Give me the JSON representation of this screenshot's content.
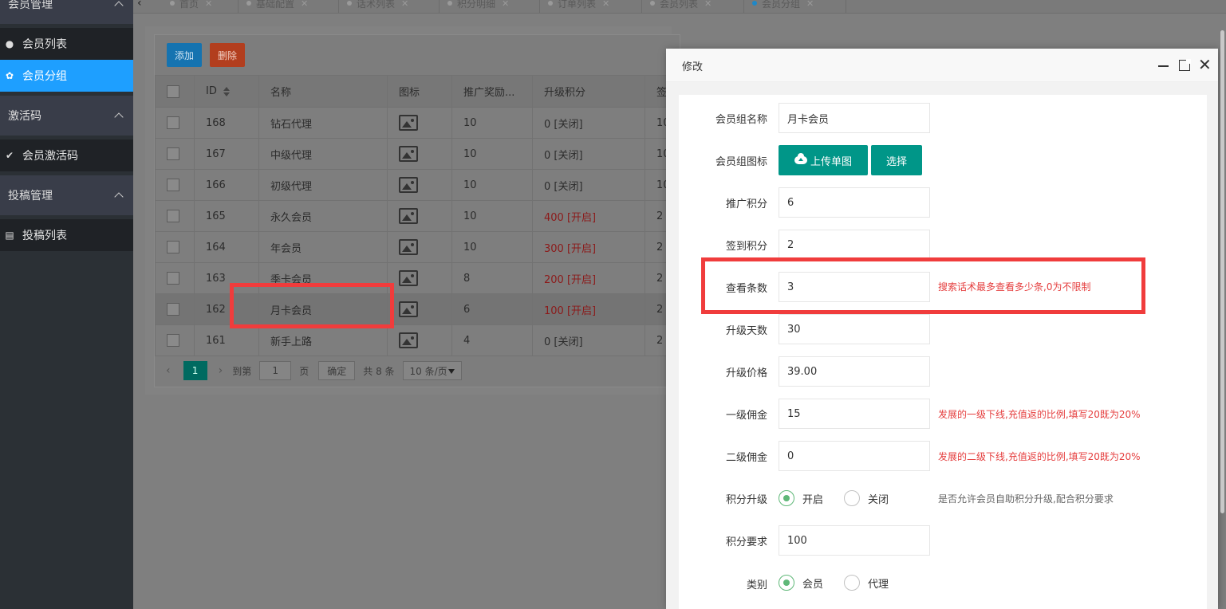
{
  "sidebar": {
    "groups": [
      {
        "label": "会员管理",
        "items": [
          {
            "label": "会员列表",
            "icon": "user-icon"
          },
          {
            "label": "会员分组",
            "icon": "group-icon",
            "active": true
          }
        ]
      },
      {
        "label": "激活码",
        "items": [
          {
            "label": "会员激活码",
            "icon": "check-icon"
          }
        ]
      },
      {
        "label": "投稿管理",
        "items": [
          {
            "label": "投稿列表",
            "icon": "list-icon"
          }
        ]
      }
    ]
  },
  "tabs": [
    {
      "label": "首页"
    },
    {
      "label": "基础配置"
    },
    {
      "label": "话术列表"
    },
    {
      "label": "积分明细"
    },
    {
      "label": "订单列表"
    },
    {
      "label": "会员列表"
    },
    {
      "label": "会员分组",
      "active": true
    }
  ],
  "toolbar": {
    "add_label": "添加",
    "delete_label": "删除"
  },
  "table": {
    "headers": [
      "ID",
      "名称",
      "图标",
      "推广奖励...",
      "升级积分",
      "签"
    ],
    "rows": [
      {
        "id": "168",
        "name": "钻石代理",
        "promo": "10",
        "upgrade": "0 [关闭]",
        "sign": "10",
        "red": false
      },
      {
        "id": "167",
        "name": "中级代理",
        "promo": "10",
        "upgrade": "0 [关闭]",
        "sign": "10",
        "red": false
      },
      {
        "id": "166",
        "name": "初级代理",
        "promo": "10",
        "upgrade": "0 [关闭]",
        "sign": "10",
        "red": false
      },
      {
        "id": "165",
        "name": "永久会员",
        "promo": "10",
        "upgrade": "400 [开启]",
        "sign": "2",
        "red": true
      },
      {
        "id": "164",
        "name": "年会员",
        "promo": "10",
        "upgrade": "300 [开启]",
        "sign": "2",
        "red": true
      },
      {
        "id": "163",
        "name": "季卡会员",
        "promo": "8",
        "upgrade": "200 [开启]",
        "sign": "2",
        "red": true
      },
      {
        "id": "162",
        "name": "月卡会员",
        "promo": "6",
        "upgrade": "100 [开启]",
        "sign": "2",
        "red": true,
        "highlight": true
      },
      {
        "id": "161",
        "name": "新手上路",
        "promo": "4",
        "upgrade": "0 [关闭]",
        "sign": "2",
        "red": false
      }
    ]
  },
  "pager": {
    "current": "1",
    "goto_label": "到第",
    "page_input": "1",
    "page_label": "页",
    "confirm_label": "确定",
    "total": "共 8 条",
    "page_size": "10 条/页"
  },
  "modal": {
    "title": "修改",
    "fields": {
      "group_name": {
        "label": "会员组名称",
        "value": "月卡会员"
      },
      "group_icon": {
        "label": "会员组图标",
        "upload_label": "上传单图",
        "select_label": "选择"
      },
      "promo_points": {
        "label": "推广积分",
        "value": "6"
      },
      "sign_points": {
        "label": "签到积分",
        "value": "2"
      },
      "view_count": {
        "label": "查看条数",
        "value": "3",
        "tip": "搜索话术最多查看多少条,0为不限制"
      },
      "upgrade_days": {
        "label": "升级天数",
        "value": "30"
      },
      "upgrade_price": {
        "label": "升级价格",
        "value": "39.00"
      },
      "commission_1": {
        "label": "一级佣金",
        "value": "15",
        "tip": "发展的一级下线,充值返的比例,填写20既为20%"
      },
      "commission_2": {
        "label": "二级佣金",
        "value": "0",
        "tip": "发展的二级下线,充值返的比例,填写20既为20%"
      },
      "points_upgrade": {
        "label": "积分升级",
        "on_label": "开启",
        "off_label": "关闭",
        "selected": "开启",
        "tip": "是否允许会员自助积分升级,配合积分要求"
      },
      "points_required": {
        "label": "积分要求",
        "value": "100"
      },
      "category": {
        "label": "类别",
        "member_label": "会员",
        "agent_label": "代理",
        "selected": "会员"
      }
    }
  },
  "colors": {
    "sidebar": "#2b3035",
    "active": "#1e9fff",
    "teal": "#009688",
    "tip_red": "#e53e3e",
    "highlight_box": "#f03c3c"
  }
}
